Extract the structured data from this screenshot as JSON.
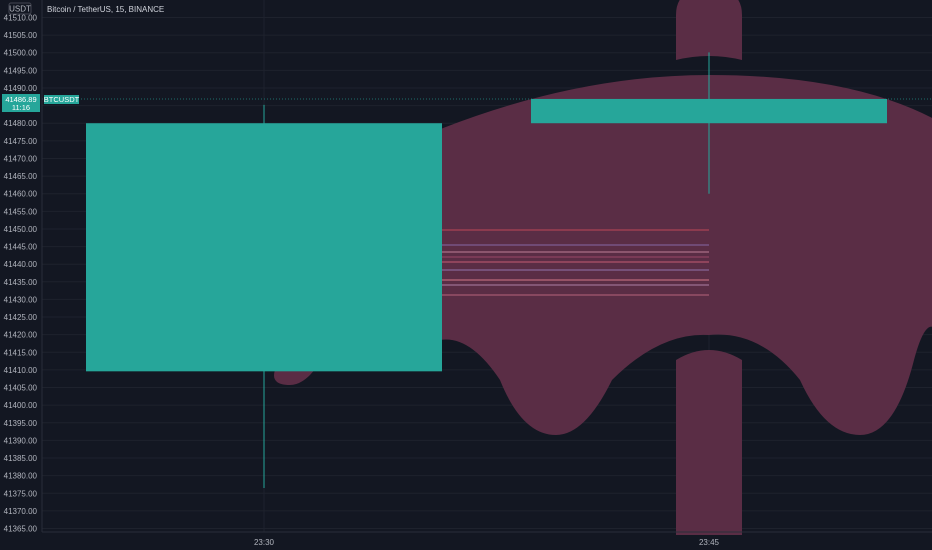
{
  "header": {
    "currency_badge": "USDT",
    "symbol_title": "Bitcoin / TetherUS, 15, BINANCE"
  },
  "price_tag": {
    "price": "41486.89",
    "countdown": "11:16",
    "symbol": "BTCUSDT"
  },
  "colors": {
    "background": "#131722",
    "grid": "#2a2e39",
    "candle_up": "#26a69a",
    "logo_shape": "#5a2d45",
    "axis_text": "#b2b5be"
  },
  "logo": {
    "icon": "umbrella-icon"
  },
  "chart_data": {
    "type": "candlestick",
    "x_ticks": [
      "23:30",
      "23:45"
    ],
    "ylim": [
      41362,
      41512
    ],
    "y_ticks": [
      41365,
      41370,
      41375,
      41380,
      41385,
      41390,
      41395,
      41400,
      41405,
      41410,
      41415,
      41420,
      41425,
      41430,
      41435,
      41440,
      41445,
      41450,
      41455,
      41460,
      41465,
      41470,
      41475,
      41480,
      41485,
      41490,
      41495,
      41500,
      41505,
      41510
    ],
    "candles": [
      {
        "time": "23:30",
        "open": 41409.6,
        "high": 41485.2,
        "low": 41376.5,
        "close": 41480.0
      },
      {
        "time": "23:45",
        "open": 41480.0,
        "high": 41500.1,
        "low": 41460.0,
        "close": 41486.89
      }
    ],
    "last_price": 41486.89,
    "grid": true
  }
}
